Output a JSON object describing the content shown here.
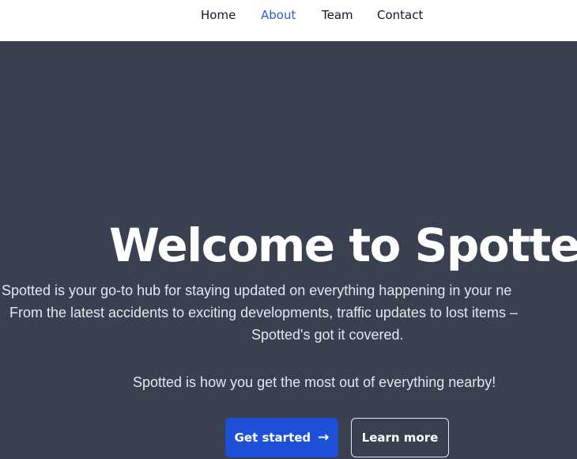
{
  "nav": {
    "items": [
      {
        "label": "Home"
      },
      {
        "label": "About"
      },
      {
        "label": "Team"
      },
      {
        "label": "Contact"
      }
    ],
    "active": "About"
  },
  "hero": {
    "title": "Welcome to Spotted",
    "description_lines": [
      "Spotted is your go-to hub for staying updated on everything happening in your ne",
      "From the latest accidents to exciting developments, traffic updates to lost items –",
      "Spotted's got it covered."
    ],
    "tagline": "Spotted is how you get the most out of everything nearby!",
    "primary_button": {
      "label": "Get started",
      "icon": "arrow-right-icon"
    },
    "secondary_button": {
      "label": "Learn more"
    }
  },
  "colors": {
    "hero_background": "#394050",
    "accent": "#1d4fd8",
    "nav_active": "#2f5bd6"
  }
}
